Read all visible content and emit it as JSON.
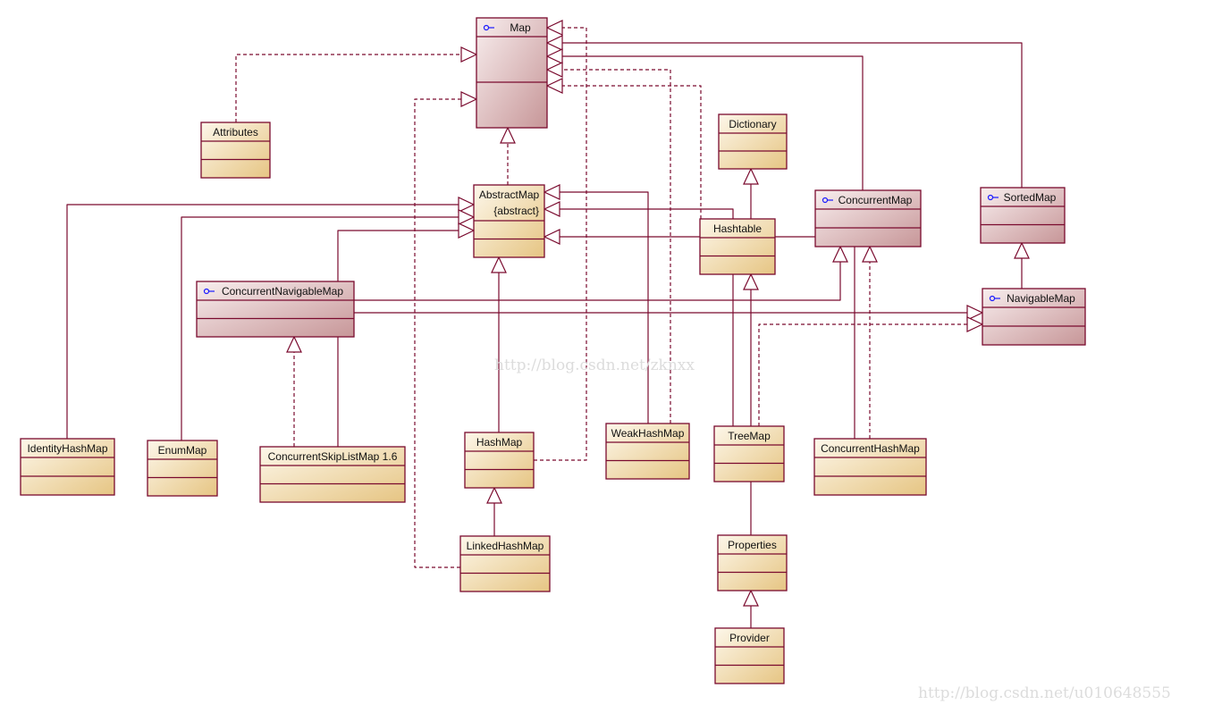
{
  "colors": {
    "line": "#7a0a2e",
    "class_light": "#fdf7ea",
    "class_dark": "#e6c583",
    "interface_light": "#f8eeee",
    "interface_dark": "#c79698",
    "interface_icon": "#1a1aff",
    "watermark": "#d8d8d8"
  },
  "boxes": [
    {
      "name": "Map",
      "kind": "interface",
      "icon": "interface-lollipop-icon"
    },
    {
      "name": "Attributes",
      "kind": "class"
    },
    {
      "name": "AbstractMap",
      "kind": "class",
      "stereotype": "{abstract}"
    },
    {
      "name": "Dictionary",
      "kind": "class"
    },
    {
      "name": "Hashtable",
      "kind": "class"
    },
    {
      "name": "ConcurrentMap",
      "kind": "interface",
      "icon": "interface-lollipop-icon"
    },
    {
      "name": "SortedMap",
      "kind": "interface",
      "icon": "interface-lollipop-icon"
    },
    {
      "name": "NavigableMap",
      "kind": "interface",
      "icon": "interface-lollipop-icon"
    },
    {
      "name": "ConcurrentNavigableMap",
      "kind": "interface",
      "icon": "interface-lollipop-icon"
    },
    {
      "name": "IdentityHashMap",
      "kind": "class"
    },
    {
      "name": "EnumMap",
      "kind": "class"
    },
    {
      "name": "ConcurrentSkipListMap 1.6",
      "kind": "class"
    },
    {
      "name": "HashMap",
      "kind": "class"
    },
    {
      "name": "WeakHashMap",
      "kind": "class"
    },
    {
      "name": "TreeMap",
      "kind": "class"
    },
    {
      "name": "ConcurrentHashMap",
      "kind": "class"
    },
    {
      "name": "LinkedHashMap",
      "kind": "class"
    },
    {
      "name": "Properties",
      "kind": "class"
    },
    {
      "name": "Provider",
      "kind": "class"
    }
  ],
  "edges": [
    {
      "from": "HashMap",
      "to": "Map",
      "type": "realization"
    },
    {
      "from": "SortedMap",
      "to": "Map",
      "type": "generalization"
    },
    {
      "from": "ConcurrentMap",
      "to": "Map",
      "type": "generalization"
    },
    {
      "from": "WeakHashMap",
      "to": "Map",
      "type": "realization"
    },
    {
      "from": "Hashtable",
      "to": "Map",
      "type": "realization"
    },
    {
      "from": "Attributes",
      "to": "Map",
      "type": "realization"
    },
    {
      "from": "LinkedHashMap",
      "to": "Map",
      "type": "realization"
    },
    {
      "from": "AbstractMap",
      "to": "Map",
      "type": "realization"
    },
    {
      "from": "WeakHashMap",
      "to": "AbstractMap",
      "type": "generalization"
    },
    {
      "from": "TreeMap",
      "to": "AbstractMap",
      "type": "generalization"
    },
    {
      "from": "ConcurrentHashMap",
      "to": "AbstractMap",
      "type": "generalization"
    },
    {
      "from": "IdentityHashMap",
      "to": "AbstractMap",
      "type": "generalization"
    },
    {
      "from": "EnumMap",
      "to": "AbstractMap",
      "type": "generalization"
    },
    {
      "from": "ConcurrentSkipListMap 1.6",
      "to": "AbstractMap",
      "type": "generalization"
    },
    {
      "from": "HashMap",
      "to": "AbstractMap",
      "type": "generalization"
    },
    {
      "from": "Hashtable",
      "to": "Dictionary",
      "type": "generalization"
    },
    {
      "from": "LinkedHashMap",
      "to": "HashMap",
      "type": "generalization"
    },
    {
      "from": "Properties",
      "to": "Hashtable",
      "type": "generalization"
    },
    {
      "from": "Provider",
      "to": "Properties",
      "type": "generalization"
    },
    {
      "from": "ConcurrentHashMap",
      "to": "ConcurrentMap",
      "type": "realization"
    },
    {
      "from": "ConcurrentNavigableMap",
      "to": "ConcurrentMap",
      "type": "generalization"
    },
    {
      "from": "ConcurrentNavigableMap",
      "to": "NavigableMap",
      "type": "generalization"
    },
    {
      "from": "TreeMap",
      "to": "NavigableMap",
      "type": "realization"
    },
    {
      "from": "NavigableMap",
      "to": "SortedMap",
      "type": "generalization"
    },
    {
      "from": "ConcurrentSkipListMap 1.6",
      "to": "ConcurrentNavigableMap",
      "type": "realization"
    }
  ],
  "watermarks": [
    "http://blog.csdn.net/zknxx",
    "http://blog.csdn.net/u010648555"
  ]
}
